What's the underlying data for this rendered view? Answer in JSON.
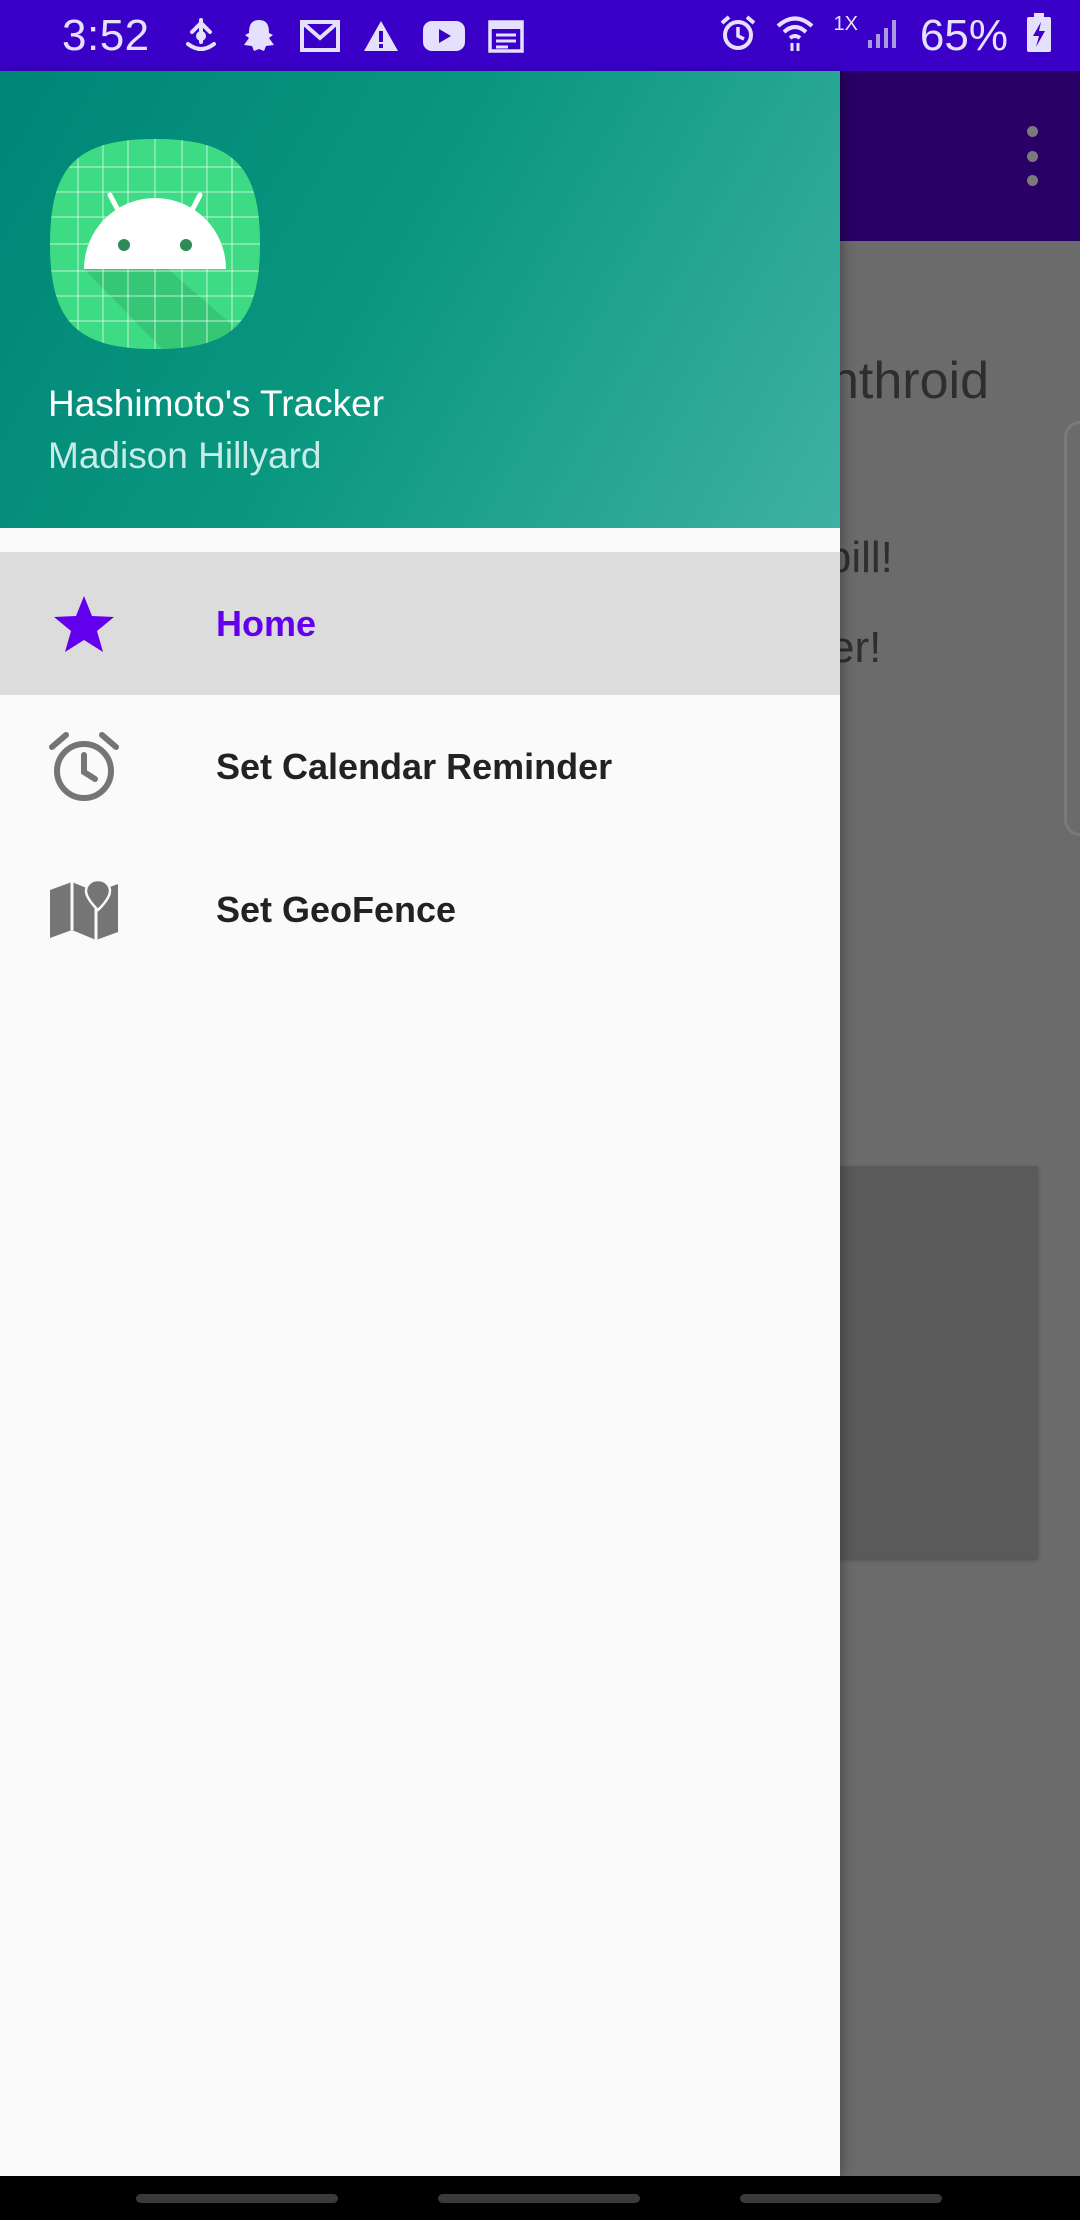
{
  "status_bar": {
    "time": "3:52",
    "network_speed": "1X",
    "battery_percent": "65%",
    "icons": [
      "sailboat-icon",
      "snapchat-icon",
      "gmail-icon",
      "warning-icon",
      "youtube-icon",
      "calendar-icon",
      "alarm-icon",
      "wifi-icon",
      "signal-icon",
      "battery-charging-icon"
    ]
  },
  "background_app": {
    "title_fragment": "nthroid",
    "line_1_fragment": "r pill!",
    "line_2_fragment": "er!",
    "toolbar_color": "#290065",
    "overflow_icon": "more-vert-icon"
  },
  "drawer": {
    "header": {
      "title": "Hashimoto's Tracker",
      "subtitle": "Madison Hillyard",
      "logo_icon": "android-app-logo-icon",
      "gradient_start": "#008577",
      "gradient_end": "#3fb1a4"
    },
    "items": [
      {
        "label": "Home",
        "icon": "star-icon",
        "selected": true
      },
      {
        "label": "Set Calendar Reminder",
        "icon": "alarm-clock-icon",
        "selected": false
      },
      {
        "label": "Set GeoFence",
        "icon": "map-pin-icon",
        "selected": false
      }
    ],
    "accent_color": "#6200ee"
  }
}
